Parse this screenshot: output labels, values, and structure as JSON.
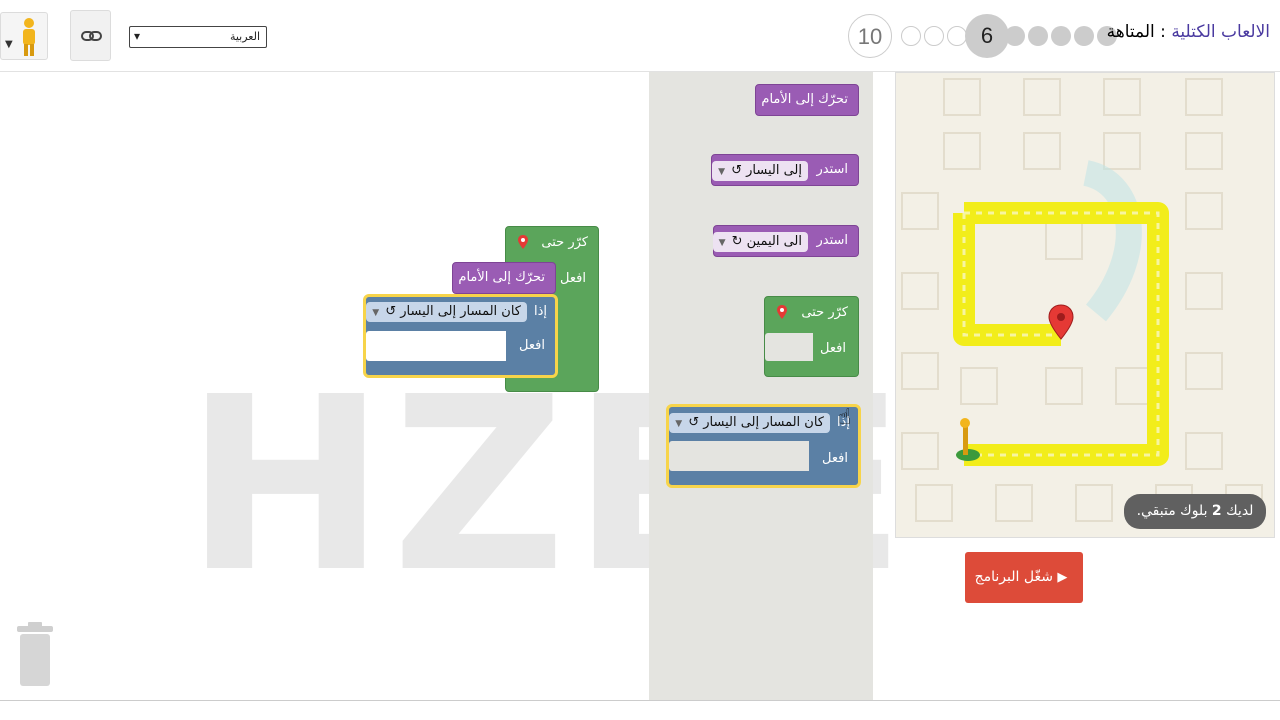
{
  "header": {
    "app_name": "الالعاب الكتلية",
    "separator": ":",
    "page_name": "المتاهة",
    "language": "العربية",
    "levels": {
      "current": "6",
      "last": "10"
    }
  },
  "maze": {
    "hint_text_pre": "لديك",
    "hint_count": "2",
    "hint_text_post": "بلوك متبقي.",
    "run_label": "شغّل البرنامج"
  },
  "toolbox": {
    "move_forward": "تحرّك إلى الأمام",
    "turn_label": "استدر",
    "turn_left": "إلى اليسار ↺",
    "turn_right": "الى اليمين ↻",
    "repeat_until": "كرّر حتى",
    "do_label": "افعل",
    "if_label": "إذا",
    "if_path_left": "كان المسار إلى اليسار ↺"
  },
  "workspace": {
    "repeat_until": "كرّر حتى",
    "do_label": "افعل",
    "move_forward": "تحرّك إلى الأمام",
    "if_label": "إذا",
    "if_path_left": "كان المسار إلى اليسار ↺",
    "if_do_label": "افعل"
  },
  "watermark": "HZEE",
  "icons": {
    "pegman": "pegman-icon",
    "link": "link-icon",
    "trash": "trash-icon",
    "pin": "map-pin-icon",
    "play": "play-icon"
  },
  "colors": {
    "motion": "#9a5cb4",
    "loop": "#5ba55b",
    "logic": "#5b80a5",
    "run_button": "#dd4b39",
    "road": "#f7f237"
  }
}
